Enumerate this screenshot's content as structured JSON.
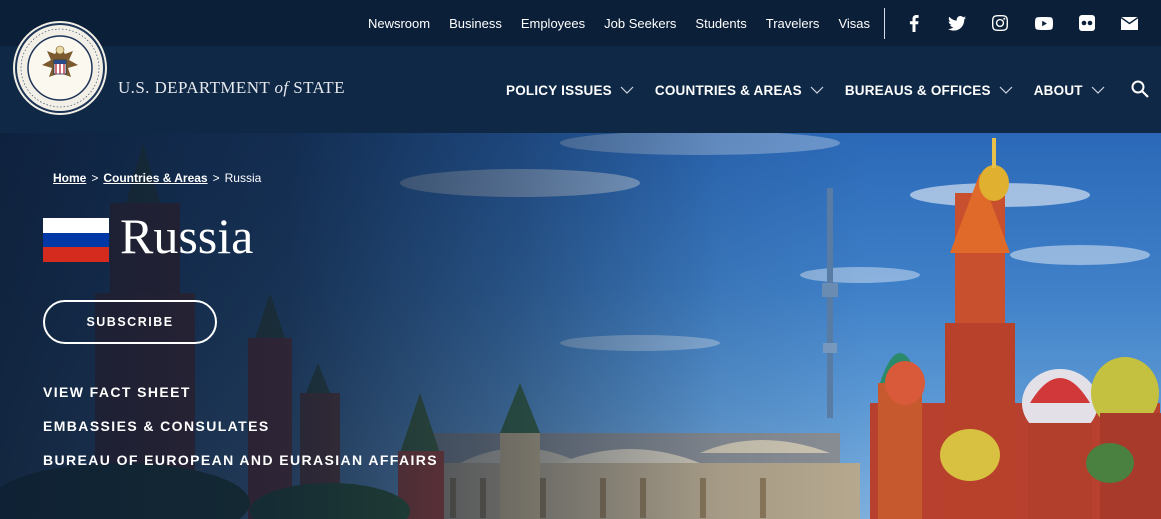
{
  "utility_nav": [
    "Newsroom",
    "Business",
    "Employees",
    "Job Seekers",
    "Students",
    "Travelers",
    "Visas"
  ],
  "social_icons": [
    "facebook-icon",
    "twitter-icon",
    "instagram-icon",
    "youtube-icon",
    "flickr-icon",
    "email-icon"
  ],
  "brand": {
    "prefix": "U.S. DEPARTMENT ",
    "of": "of",
    "suffix": " STATE"
  },
  "main_nav": [
    "POLICY ISSUES",
    "COUNTRIES & AREAS",
    "BUREAUS & OFFICES",
    "ABOUT"
  ],
  "breadcrumb": {
    "home": "Home",
    "sep1": ">",
    "countries": "Countries & Areas",
    "sep2": ">",
    "current": "Russia"
  },
  "page": {
    "title": "Russia",
    "subscribe_label": "SUBSCRIBE"
  },
  "quick_links": [
    "VIEW FACT SHEET",
    "EMBASSIES & CONSULATES",
    "BUREAU OF EUROPEAN AND EURASIAN AFFAIRS"
  ],
  "colors": {
    "header_bg": "#0f2846",
    "utility_bg": "#0b1f38",
    "flag_white": "#ffffff",
    "flag_blue": "#0039a6",
    "flag_red": "#d52b1e"
  }
}
